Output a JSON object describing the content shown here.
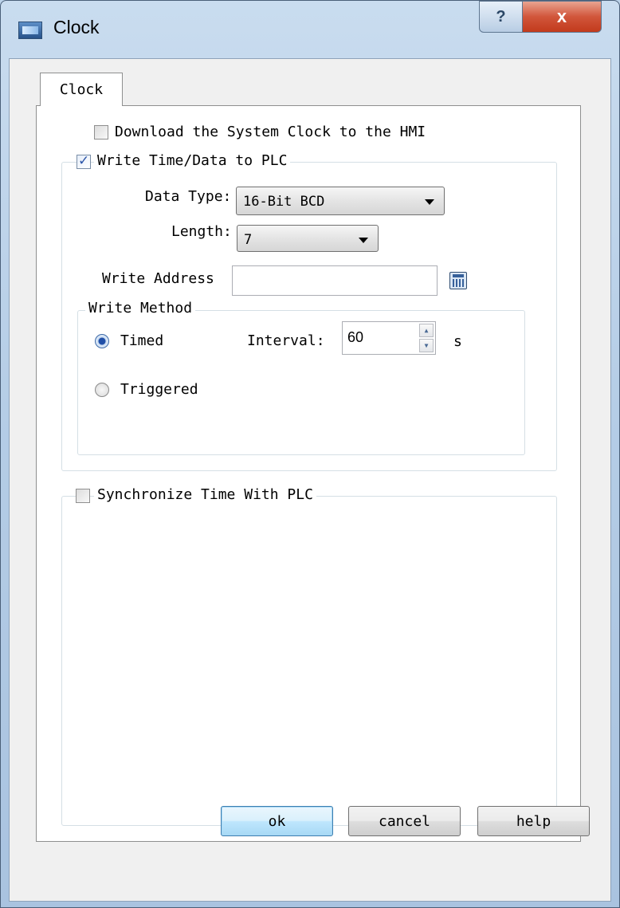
{
  "window": {
    "title": "Clock",
    "help_glyph": "?",
    "close_glyph": "x"
  },
  "tab": {
    "label": "Clock"
  },
  "download_clock": {
    "label": "Download the System Clock to the HMI",
    "checked": false
  },
  "write_time": {
    "label": "Write Time/Data to PLC",
    "checked": true,
    "data_type": {
      "label": "Data Type:",
      "value": "16-Bit BCD"
    },
    "length": {
      "label": "Length:",
      "value": "7"
    },
    "write_address": {
      "label": "Write Address",
      "value": ""
    },
    "write_method": {
      "legend": "Write Method",
      "timed": {
        "label": "Timed",
        "selected": true
      },
      "interval": {
        "label": "Interval:",
        "value": "60",
        "unit": "s"
      },
      "triggered": {
        "label": "Triggered",
        "selected": false
      }
    }
  },
  "sync_time": {
    "label": "Synchronize Time With PLC",
    "checked": false
  },
  "buttons": {
    "ok": "ok",
    "cancel": "cancel",
    "help": "help"
  },
  "icons": {
    "window_icon": "clock-window-icon",
    "calculator": "calculator-icon",
    "spin_up": "spin-up-icon",
    "spin_down": "spin-down-icon"
  }
}
